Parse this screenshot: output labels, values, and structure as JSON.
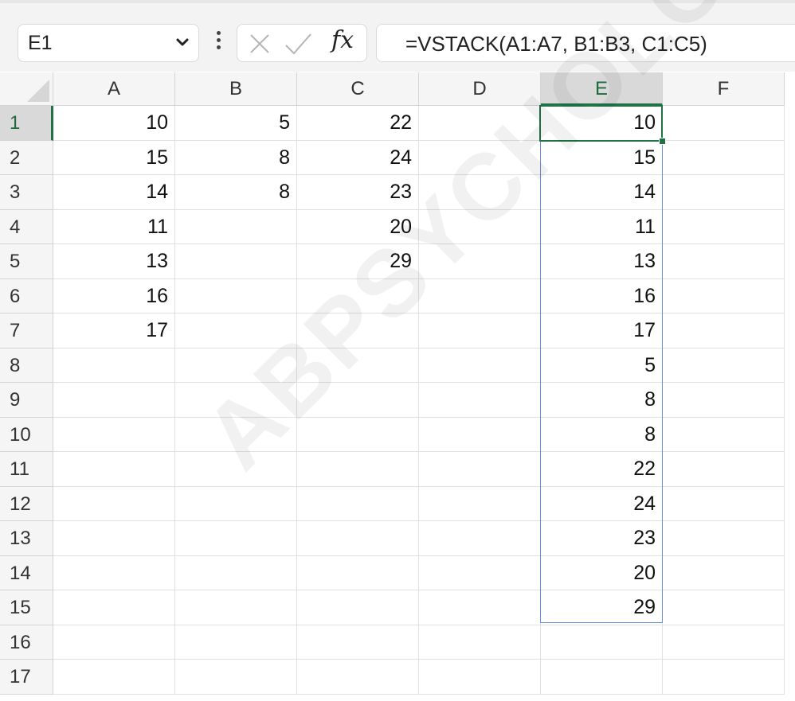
{
  "formula_bar": {
    "name_box": "E1",
    "formula": "=VSTACK(A1:A7, B1:B3, C1:C5)",
    "fx_label": "fx"
  },
  "columns": [
    "A",
    "B",
    "C",
    "D",
    "E",
    "F"
  ],
  "selected_column": "E",
  "rows": [
    "1",
    "2",
    "3",
    "4",
    "5",
    "6",
    "7",
    "8",
    "9",
    "10",
    "11",
    "12",
    "13",
    "14",
    "15",
    "16",
    "17"
  ],
  "selected_row": "1",
  "cells": {
    "A": [
      "10",
      "15",
      "14",
      "11",
      "13",
      "16",
      "17",
      "",
      "",
      "",
      "",
      "",
      "",
      "",
      "",
      "",
      ""
    ],
    "B": [
      "5",
      "8",
      "8",
      "",
      "",
      "",
      "",
      "",
      "",
      "",
      "",
      "",
      "",
      "",
      "",
      "",
      ""
    ],
    "C": [
      "22",
      "24",
      "23",
      "20",
      "29",
      "",
      "",
      "",
      "",
      "",
      "",
      "",
      "",
      "",
      "",
      "",
      ""
    ],
    "D": [
      "",
      "",
      "",
      "",
      "",
      "",
      "",
      "",
      "",
      "",
      "",
      "",
      "",
      "",
      "",
      "",
      ""
    ],
    "E": [
      "10",
      "15",
      "14",
      "11",
      "13",
      "16",
      "17",
      "5",
      "8",
      "8",
      "22",
      "24",
      "23",
      "20",
      "29",
      "",
      ""
    ],
    "F": [
      "",
      "",
      "",
      "",
      "",
      "",
      "",
      "",
      "",
      "",
      "",
      "",
      "",
      "",
      "",
      "",
      ""
    ]
  },
  "watermark": "ABPSYCHOLOGY.C",
  "colors": {
    "accent": "#217346",
    "spill_border": "#6a8fd8"
  }
}
